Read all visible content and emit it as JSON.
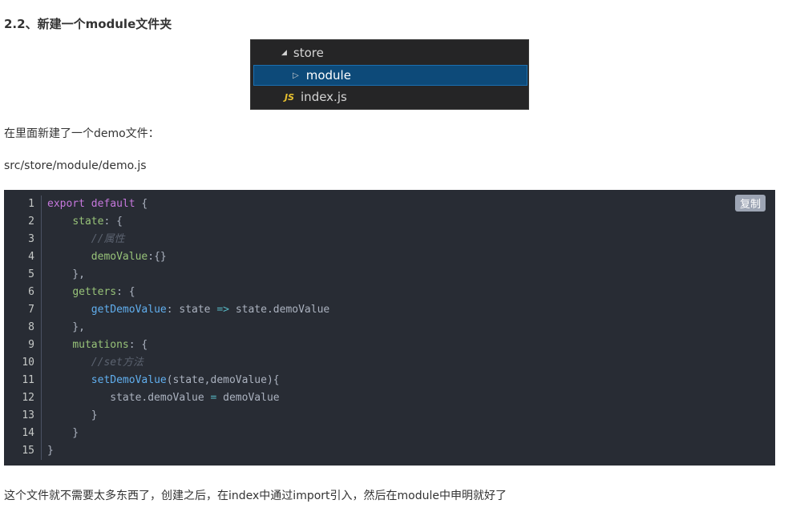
{
  "heading": "2.2、新建一个module文件夹",
  "tree": {
    "items": [
      {
        "icon": "triangle-down-icon",
        "label": "store"
      },
      {
        "icon": "triangle-right-icon",
        "label": "module",
        "selected": true
      },
      {
        "icon": "js-file-icon",
        "badge": "JS",
        "label": "index.js"
      }
    ]
  },
  "para1": "在里面新建了一个demo文件：",
  "para2": "src/store/module/demo.js",
  "code": {
    "copy_label": "复制",
    "line_numbers": [
      "1",
      "2",
      "3",
      "4",
      "5",
      "6",
      "7",
      "8",
      "9",
      "10",
      "11",
      "12",
      "13",
      "14",
      "15"
    ],
    "lines": [
      [
        {
          "t": "export default",
          "c": "kw"
        },
        {
          "t": " {",
          "c": "pl"
        }
      ],
      [
        {
          "t": "    ",
          "c": "pl"
        },
        {
          "t": "state",
          "c": "prop"
        },
        {
          "t": ": {",
          "c": "pl"
        }
      ],
      [
        {
          "t": "       ",
          "c": "pl"
        },
        {
          "t": "//属性",
          "c": "cm"
        }
      ],
      [
        {
          "t": "       ",
          "c": "pl"
        },
        {
          "t": "demoValue",
          "c": "prop"
        },
        {
          "t": ":{}",
          "c": "pl"
        }
      ],
      [
        {
          "t": "    },",
          "c": "pl"
        }
      ],
      [
        {
          "t": "    ",
          "c": "pl"
        },
        {
          "t": "getters",
          "c": "prop"
        },
        {
          "t": ": {",
          "c": "pl"
        }
      ],
      [
        {
          "t": "       ",
          "c": "pl"
        },
        {
          "t": "getDemoValue",
          "c": "fn"
        },
        {
          "t": ": state ",
          "c": "pl"
        },
        {
          "t": "=>",
          "c": "op"
        },
        {
          "t": " state.demoValue",
          "c": "pl"
        }
      ],
      [
        {
          "t": "    },",
          "c": "pl"
        }
      ],
      [
        {
          "t": "    ",
          "c": "pl"
        },
        {
          "t": "mutations",
          "c": "prop"
        },
        {
          "t": ": {",
          "c": "pl"
        }
      ],
      [
        {
          "t": "       ",
          "c": "pl"
        },
        {
          "t": "//set方法",
          "c": "cm"
        }
      ],
      [
        {
          "t": "       ",
          "c": "pl"
        },
        {
          "t": "setDemoValue",
          "c": "fn"
        },
        {
          "t": "(state,demoValue){",
          "c": "pl"
        }
      ],
      [
        {
          "t": "          state.demoValue ",
          "c": "pl"
        },
        {
          "t": "=",
          "c": "op"
        },
        {
          "t": " demoValue",
          "c": "pl"
        }
      ],
      [
        {
          "t": "       }",
          "c": "pl"
        }
      ],
      [
        {
          "t": "    }",
          "c": "pl"
        }
      ],
      [
        {
          "t": "}",
          "c": "pl"
        }
      ]
    ]
  },
  "para3": "这个文件就不需要太多东西了，创建之后，在index中通过import引入，然后在module中申明就好了"
}
